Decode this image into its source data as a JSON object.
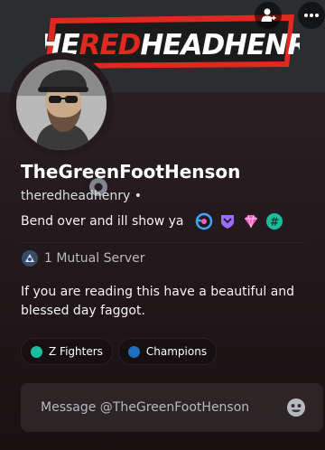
{
  "banner": {
    "logo_prefix": "THE",
    "logo_highlight": "RED",
    "logo_suffix": "HEADHENRY",
    "add_friend_icon": "add-friend-icon",
    "more_icon": "more-dots-icon"
  },
  "profile": {
    "display_name": "TheGreenFootHenson",
    "username": "theredheadhenry",
    "username_separator": "•",
    "custom_status": "Bend over and ill show ya",
    "status_indicator": "offline",
    "badges": [
      {
        "name": "hypesquad-badge",
        "color": "#3ea6ff"
      },
      {
        "name": "shield-badge",
        "color": "#9b6cff"
      },
      {
        "name": "gem-badge",
        "color": "#f25fbf"
      },
      {
        "name": "hashtag-badge",
        "color": "#1abc9c"
      }
    ]
  },
  "mutual": {
    "label": "1 Mutual Server"
  },
  "bio": {
    "text": "If you are reading this have a beautiful and blessed day faggot."
  },
  "roles": [
    {
      "label": "Z Fighters",
      "color": "#1abc9c"
    },
    {
      "label": "Champions",
      "color": "#1f6fbf"
    }
  ],
  "message": {
    "placeholder": "Message @TheGreenFootHenson"
  },
  "colors": {
    "accent_red": "#e0281e",
    "banner_bg": "#2b2d31"
  }
}
